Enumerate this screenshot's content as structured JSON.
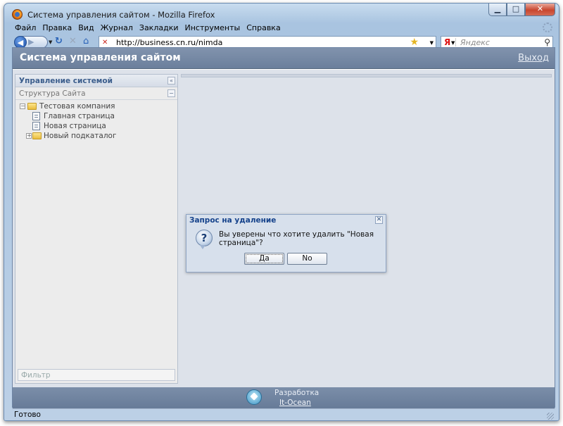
{
  "window": {
    "title": "Система управления сайтом - Mozilla Firefox"
  },
  "menu": {
    "items": [
      {
        "label": "Файл"
      },
      {
        "label": "Правка"
      },
      {
        "label": "Вид"
      },
      {
        "label": "Журнал"
      },
      {
        "label": "Закладки"
      },
      {
        "label": "Инструменты"
      },
      {
        "label": "Справка"
      }
    ]
  },
  "nav": {
    "url": "http://business.cn.ru/nimda",
    "search_placeholder": "Яндекс",
    "search_engine": "Я"
  },
  "app": {
    "title": "Система управления сайтом",
    "logout": "Выход"
  },
  "sidebar": {
    "title": "Управление системой",
    "collapse_glyph": "«",
    "section": "Структура Сайта",
    "tree": [
      {
        "label": "Тестовая компания",
        "type": "folder",
        "expander": "−",
        "level": 0
      },
      {
        "label": "Главная страница",
        "type": "page",
        "level": 1
      },
      {
        "label": "Новая страница",
        "type": "page",
        "level": 1
      },
      {
        "label": "Новый подкаталог",
        "type": "folder",
        "expander": "+",
        "level": 1
      }
    ],
    "filter_placeholder": "Фильтр"
  },
  "dialog": {
    "title": "Запрос на удаление",
    "message": "Вы уверены что хотите удалить \"Новая страница\"?",
    "yes": "Да",
    "no": "No",
    "icon": "question-icon"
  },
  "footer": {
    "line1": "Разработка",
    "line2": "It-Ocean"
  },
  "status": {
    "text": "Готово"
  }
}
